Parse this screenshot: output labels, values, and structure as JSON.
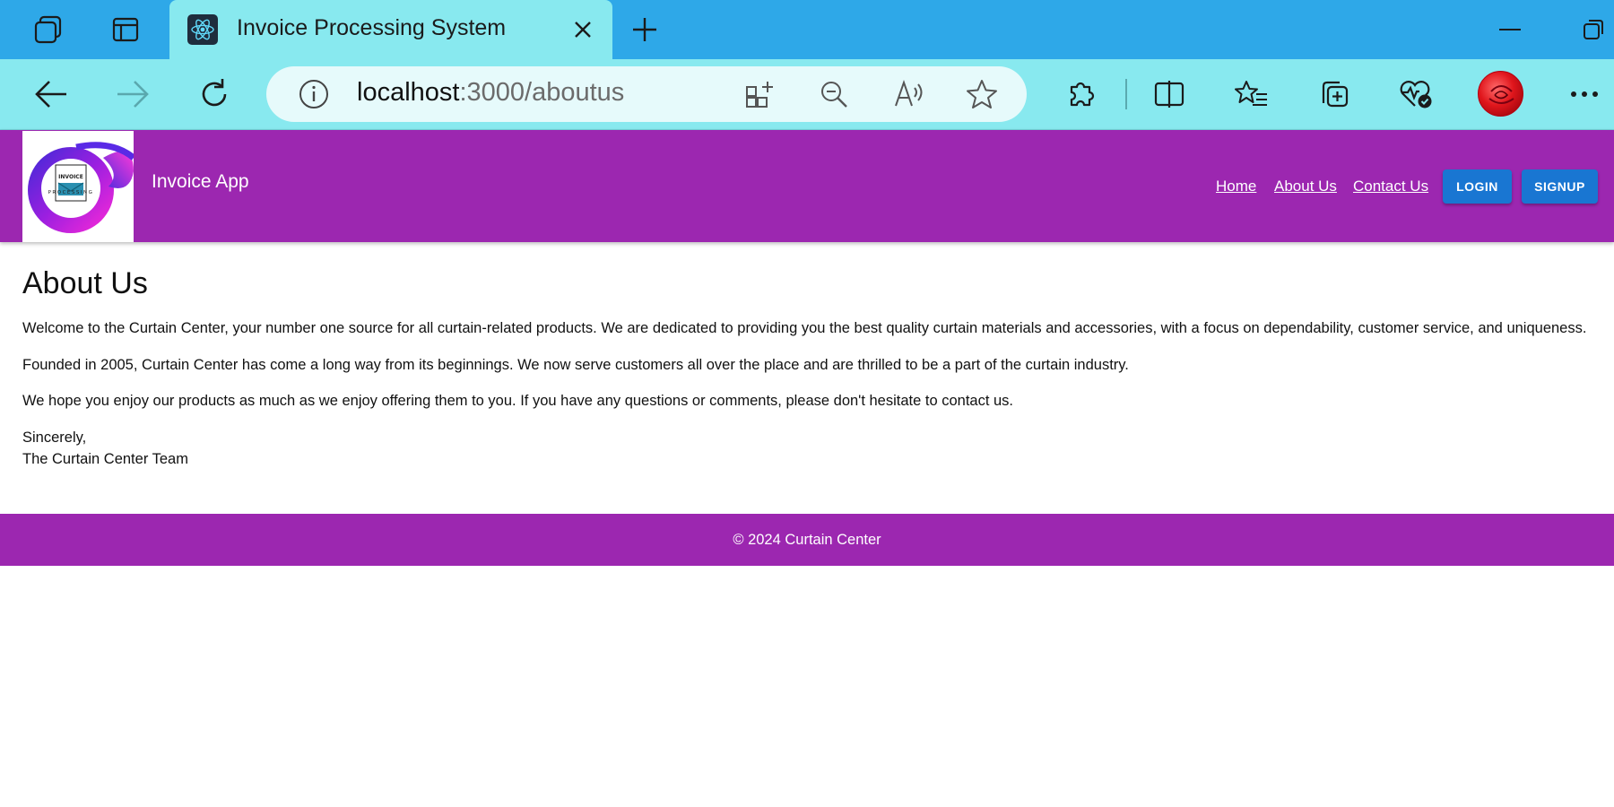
{
  "browser": {
    "tab_title": "Invoice Processing System",
    "url_host": "localhost",
    "url_rest": ":3000/aboutus",
    "icons": {
      "workspaces": "workspaces-icon",
      "tab_actions": "tab-actions-icon",
      "favicon": "react-icon",
      "close": "close-icon",
      "new_tab": "plus-icon",
      "minimize": "minimize-icon",
      "restore": "restore-icon",
      "back": "back-arrow-icon",
      "forward": "forward-arrow-icon",
      "refresh": "refresh-icon",
      "site_info": "info-icon",
      "apps": "apps-icon",
      "zoom_out": "zoom-out-icon",
      "read_aloud": "read-aloud-icon",
      "favorite": "star-icon",
      "extensions": "puzzle-icon",
      "split_screen": "split-screen-icon",
      "favorites": "favorites-list-icon",
      "collections": "collections-icon",
      "browser_essentials": "heart-pulse-icon",
      "profile": "profile-avatar",
      "more": "more-icon"
    }
  },
  "header": {
    "logo_text_top": "INVOICE",
    "logo_text_bottom": "PROCESSING",
    "brand": "Invoice App",
    "nav": [
      {
        "label": "Home"
      },
      {
        "label": "About Us"
      },
      {
        "label": "Contact Us"
      }
    ],
    "login_label": "LOGIN",
    "signup_label": "SIGNUP"
  },
  "main": {
    "title": "About Us",
    "paragraphs": [
      "Welcome to the Curtain Center, your number one source for all curtain-related products. We are dedicated to providing you the best quality curtain materials and accessories, with a focus on dependability, customer service, and uniqueness.",
      "Founded in 2005, Curtain Center has come a long way from its beginnings. We now serve customers all over the place and are thrilled to be a part of the curtain industry.",
      "We hope you enjoy our products as much as we enjoy offering them to you. If you have any questions or comments, please don't hesitate to contact us."
    ],
    "signoff_line1": "Sincerely,",
    "signoff_line2": "The Curtain Center Team"
  },
  "footer": {
    "text": "© 2024 Curtain Center"
  },
  "colors": {
    "tab_strip": "#2ea8e8",
    "toolbar": "#88e9ef",
    "app_primary": "#9c27b0",
    "button": "#1976d2"
  }
}
